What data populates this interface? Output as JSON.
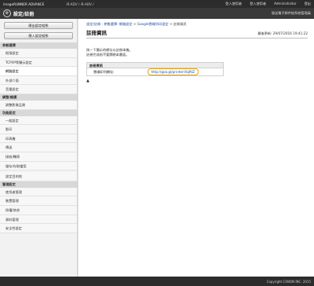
{
  "topbar": {
    "brand": "imageRUNNER ADVANCE",
    "host": "iR-ADV    / iR-ADV    /",
    "links": [
      "登入使用者",
      "登入使用者",
      "Administrator",
      "登出"
    ]
  },
  "titlebar": {
    "title": "設定/註冊",
    "mail": "發送電子郵件給系統管理員"
  },
  "sidebar": {
    "buttons": [
      "匯出設定組態",
      "匯入設定組態"
    ],
    "groups": [
      {
        "title": "參數選擇",
        "items": [
          "紙張設定",
          "TCP/IP等顯示設定",
          "網路設定",
          "外部介面",
          "音量設定"
        ]
      },
      {
        "title": "調整/維護",
        "items": [
          "調整影像品質"
        ]
      },
      {
        "title": "功能設定",
        "items": [
          "一般設定",
          "影印",
          "印表機",
          "傳送",
          "接收/轉寄",
          "儲存/存取檔案"
        ]
      },
      {
        "title": "",
        "items": [
          "設定目的地"
        ]
      },
      {
        "title": "管理設定",
        "items": [
          "使用者管理",
          "裝置管理",
          "授權/其他",
          "資料管理",
          "安全性設定"
        ]
      }
    ],
    "active": "網路設定"
  },
  "main": {
    "breadcrumb": [
      "設定/註冊",
      "參數選擇: 網路設定",
      "Google雲端列印設定",
      "註冊資訊"
    ],
    "title": "註冊資訊",
    "updated": "最後更新: 29/07/2016 19:41:22",
    "desc_line1": "按一下顯示的網址以註冊本機。",
    "desc_line2": "註冊完成前不要關閉本畫面。",
    "box_header": "註冊資訊",
    "row_label": "雲端印列網址:",
    "row_url": "http://goo.gl/printer/XqRtZ",
    "top_link": "▲"
  },
  "footer": {
    "copyright": "Copyright CANON INC. 2015"
  }
}
